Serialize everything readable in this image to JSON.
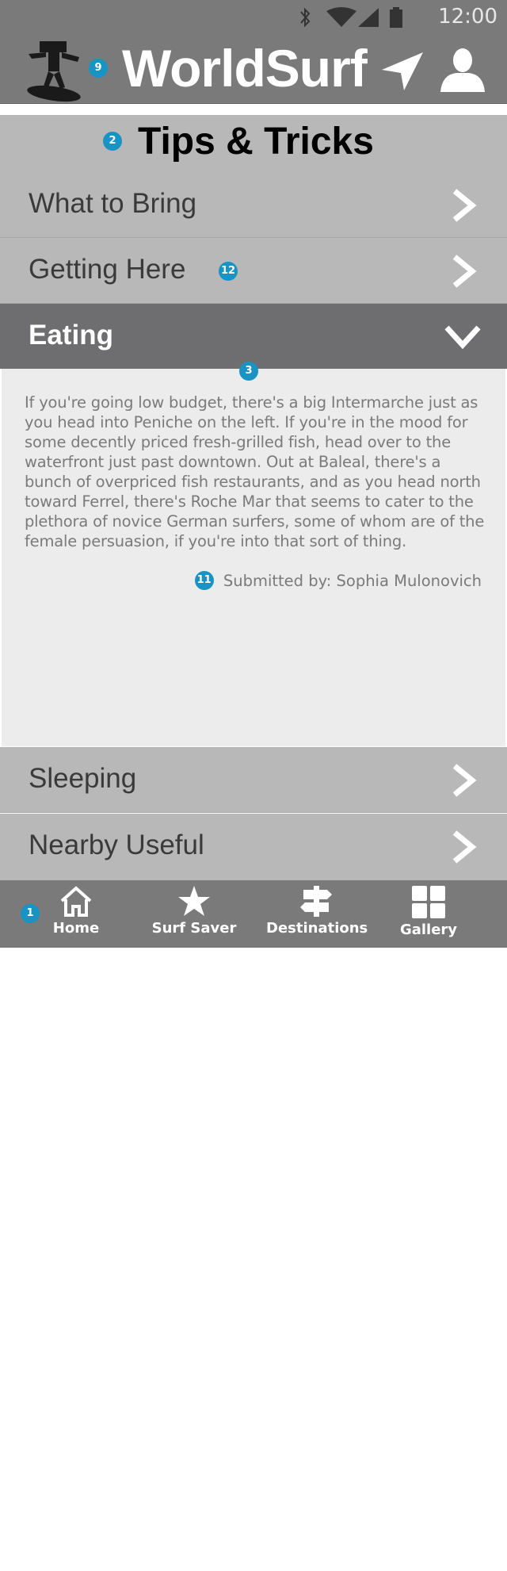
{
  "status_bar": {
    "time": "12:00"
  },
  "header": {
    "title": "WorldSurf"
  },
  "badges": {
    "header": "9",
    "title": "2",
    "getting_here": "12",
    "eating": "3",
    "submitted": "11",
    "nav": "1"
  },
  "page": {
    "title": "Tips & Tricks"
  },
  "accordion": {
    "items": [
      {
        "label": "What to Bring"
      },
      {
        "label": "Getting Here"
      },
      {
        "label": "Eating"
      },
      {
        "label": "Sleeping"
      },
      {
        "label": "Nearby Useful"
      }
    ],
    "open_index": 2
  },
  "eating": {
    "body": "If you're going low budget, there's a big Intermarche just as you head into Peniche on the left. If you're in the mood for some decently priced fresh-grilled fish, head over to the waterfront just past downtown. Out at Baleal, there's a bunch of overpriced fish restaurants, and as you head north toward Ferrel, there's Roche Mar that seems to cater to the plethora of novice German surfers, some of whom are of the female persuasion, if you're into that sort of thing.",
    "submitted_label": "Submitted by:",
    "submitted_name": "Sophia Mulonovich"
  },
  "bottom_nav": {
    "items": [
      {
        "label": "Home",
        "icon": "home-icon"
      },
      {
        "label": "Surf Saver",
        "icon": "star-icon"
      },
      {
        "label": "Destinations",
        "icon": "signpost-icon"
      },
      {
        "label": "Gallery",
        "icon": "grid-icon"
      }
    ]
  },
  "colors": {
    "chrome": "#7a7a7a",
    "row": "#b8b8b8",
    "open_row": "#6e6e70",
    "panel": "#ececec",
    "badge": "#1793c4"
  }
}
